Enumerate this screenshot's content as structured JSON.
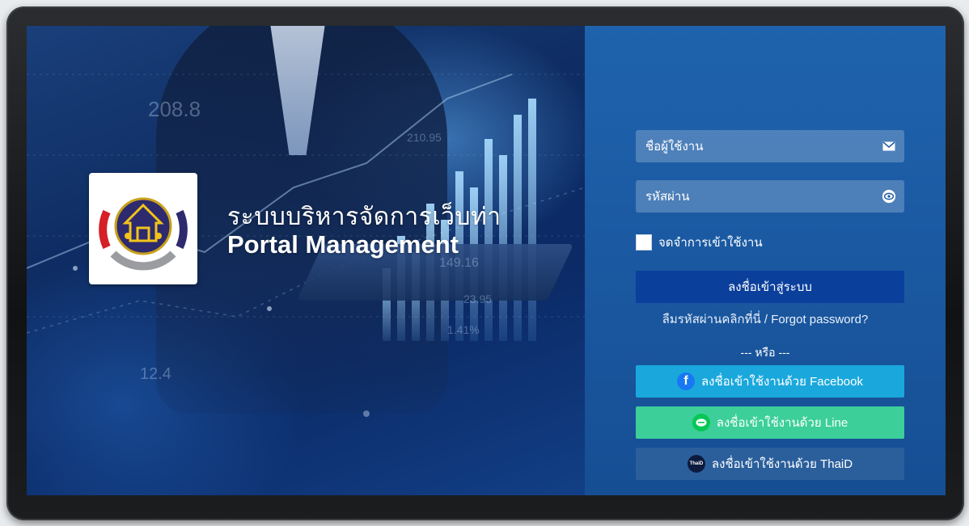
{
  "hero": {
    "title_th": "ระบบบริหารจัดการเว็บท่า",
    "title_en": "Portal Management",
    "bg_numbers": [
      "208.8",
      "210.95",
      "149.16",
      "23.95",
      "1.41%",
      "12.4"
    ]
  },
  "login": {
    "username_placeholder": "ชื่อผู้ใช้งาน",
    "username_icon": "envelope-icon",
    "password_placeholder": "รหัสผ่าน",
    "password_icon": "eye-icon",
    "remember_label": "จดจำการเข้าใช้งาน",
    "submit_label": "ลงชื่อเข้าสู่ระบบ",
    "forgot_label": "ลืมรหัสผ่านคลิกที่นี่ / Forgot password?",
    "or_label": "--- หรือ ---",
    "facebook_label": "ลงชื่อเข้าใช้งานด้วย Facebook",
    "line_label": "ลงชื่อเข้าใช้งานด้วย Line",
    "thaid_label": "ลงชื่อเข้าใช้งานด้วย ThaiD",
    "thaid_icon_text": "ThaiD"
  },
  "colors": {
    "panel_bg": "#1b5aa3",
    "login_button": "#0b3f9c",
    "facebook_button": "#1aa8dc",
    "line_button": "#3ccf9a",
    "thaid_button": "#2b5f9c"
  }
}
